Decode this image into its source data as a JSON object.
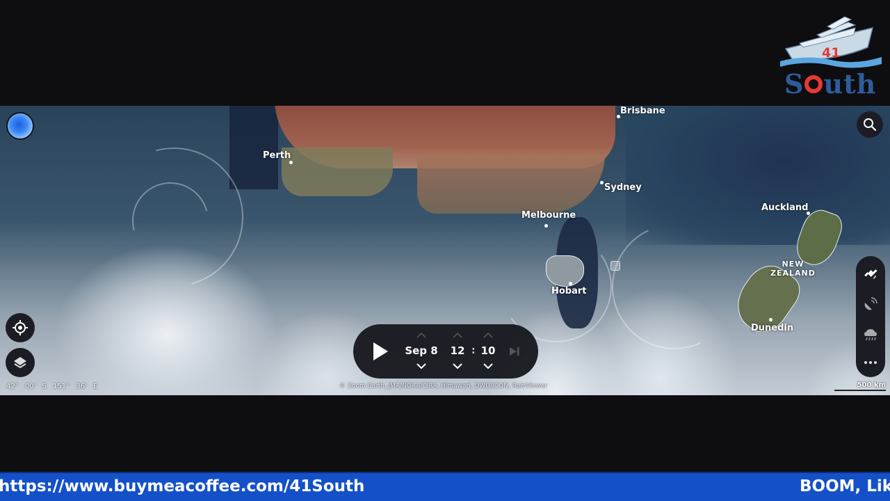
{
  "logo": {
    "brand_number": "41",
    "brand_word_before": "S",
    "brand_word_after": "uth"
  },
  "map": {
    "cities": [
      {
        "name": "Brisbane"
      },
      {
        "name": "Perth"
      },
      {
        "name": "Sydney"
      },
      {
        "name": "Melbourne"
      },
      {
        "name": "Hobart"
      },
      {
        "name": "Auckland"
      },
      {
        "name": "Dunedin"
      }
    ],
    "country_label": {
      "line1": "NEW",
      "line2": "ZEALAND"
    },
    "coordinates": "42° 00' S   151° 36' E",
    "attribution": "© Zoom Earth, JMA/NOAA/CIRA, Himawari, DWD/ICON, RainViewer",
    "scale_label": "500 km",
    "controls": {
      "app_logo_icon": "zoom-earth-logo",
      "search_icon": "search-icon",
      "locate_icon": "crosshair-locate-icon",
      "layers_icon": "layers-icon",
      "layer_panel": [
        "satellite-icon",
        "radar-icon",
        "rain-icon",
        "more-icon"
      ]
    }
  },
  "time_control": {
    "date": "Sep 8",
    "hour": "12",
    "separator": ":",
    "minute": "10"
  },
  "ticker": {
    "left_text": "https://www.buymeacoffee.com/41South",
    "right_text": "BOOM, Lik"
  },
  "colors": {
    "ticker_bg": "#1450c8",
    "control_bg": "#1c1d24",
    "logo_blue": "#2f5c9a",
    "logo_red": "#e53935"
  }
}
